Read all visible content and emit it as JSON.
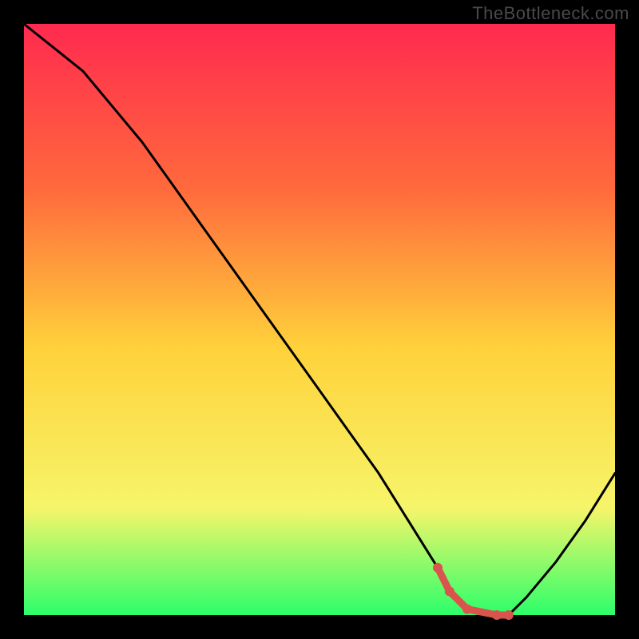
{
  "watermark": "TheBottleneck.com",
  "chart_data": {
    "type": "line",
    "title": "",
    "xlabel": "",
    "ylabel": "",
    "xlim": [
      0,
      100
    ],
    "ylim": [
      0,
      100
    ],
    "series": [
      {
        "name": "bottleneck-curve",
        "x": [
          0,
          5,
          10,
          15,
          20,
          25,
          30,
          35,
          40,
          45,
          50,
          55,
          60,
          65,
          70,
          72,
          75,
          80,
          82,
          85,
          90,
          95,
          100
        ],
        "y": [
          100,
          96,
          92,
          86,
          80,
          73,
          66,
          59,
          52,
          45,
          38,
          31,
          24,
          16,
          8,
          4,
          1,
          0,
          0,
          3,
          9,
          16,
          24
        ]
      },
      {
        "name": "optimal-range-marker",
        "x": [
          70,
          72,
          75,
          80,
          82
        ],
        "y": [
          8,
          4,
          1,
          0,
          0
        ],
        "color": "#d9544d"
      }
    ],
    "background_gradient": {
      "top": "#ff2a4f",
      "upper": "#ff6a3c",
      "mid": "#ffd23b",
      "lower": "#f6f56a",
      "bottom": "#2cff6a"
    }
  }
}
